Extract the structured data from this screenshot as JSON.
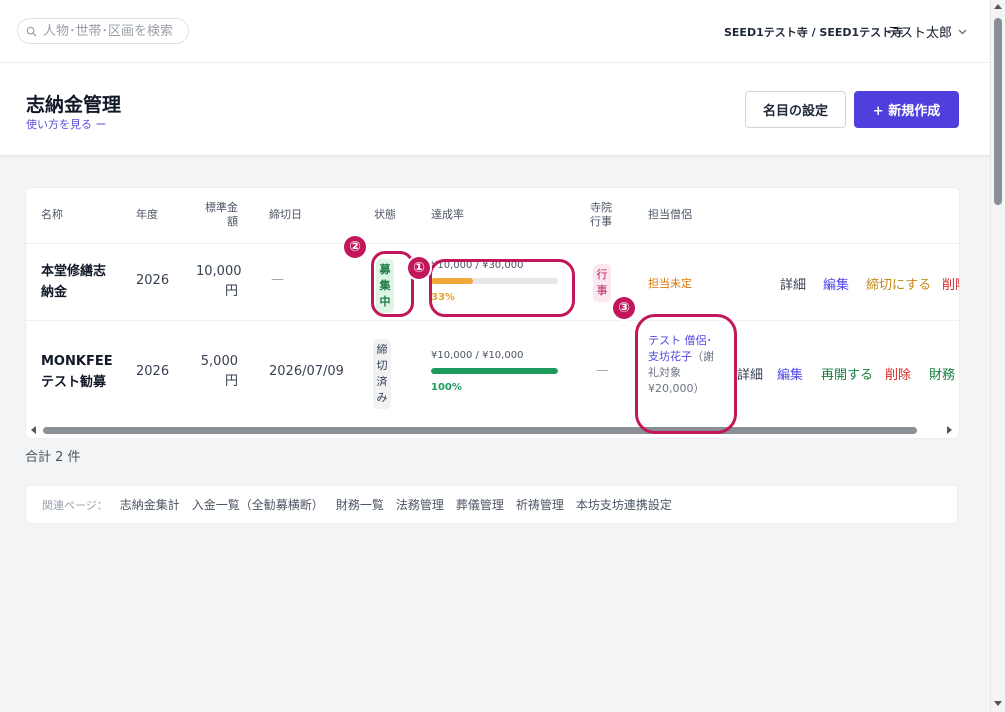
{
  "topbar": {
    "search_placeholder": "人物･世帯･区画を検索",
    "tenant": "SEED1テスト寺 / SEED1テスト寺",
    "user": "テスト太郎"
  },
  "header": {
    "title": "志納金管理",
    "howto": "使い方を見る ー",
    "settings_button": "名目の設定",
    "new_button": "+ 新規作成"
  },
  "table": {
    "columns": [
      "名称",
      "年度",
      "標準金額",
      "締切日",
      "状態",
      "達成率",
      "寺院行事",
      "担当僧侶"
    ],
    "rows": [
      {
        "name": "本堂修繕志納金",
        "year": "2026",
        "amount": "10,000円",
        "deadline": "—",
        "status": "募集中",
        "progress_text": "¥10,000 / ¥30,000",
        "progress_fraction": 0.33,
        "progress_pct": "33%",
        "progress_color": "#f0a83a",
        "event": "行事",
        "monk": "担当未定",
        "actions": [
          "詳細",
          "編集",
          "締切にする",
          "削除"
        ]
      },
      {
        "name": "MONKFEEテスト勧募",
        "year": "2026",
        "amount": "5,000円",
        "deadline": "2026/07/09",
        "status": "締切済み",
        "progress_text": "¥10,000 / ¥10,000",
        "progress_fraction": 1.0,
        "progress_pct": "100%",
        "progress_color": "#1e9a5c",
        "event": "—",
        "monk_link": "テスト 僧侶･支坊花子",
        "monk_note": "（謝礼対象 ¥20,000）",
        "actions": [
          "詳細",
          "編集",
          "再開する",
          "削除",
          "財務 -"
        ]
      }
    ]
  },
  "total": "合計 2 件",
  "related": {
    "label": "関連ページ：",
    "links": [
      "志納金集計",
      "入金一覧（全勧募横断）",
      "財務一覧",
      "法務管理",
      "葬儀管理",
      "祈祷管理",
      "本坊支坊連携設定"
    ]
  },
  "annotations": [
    "①",
    "②",
    "③"
  ],
  "colors": {
    "accent": "#4f3fdc",
    "annotation": "#c2185b"
  }
}
